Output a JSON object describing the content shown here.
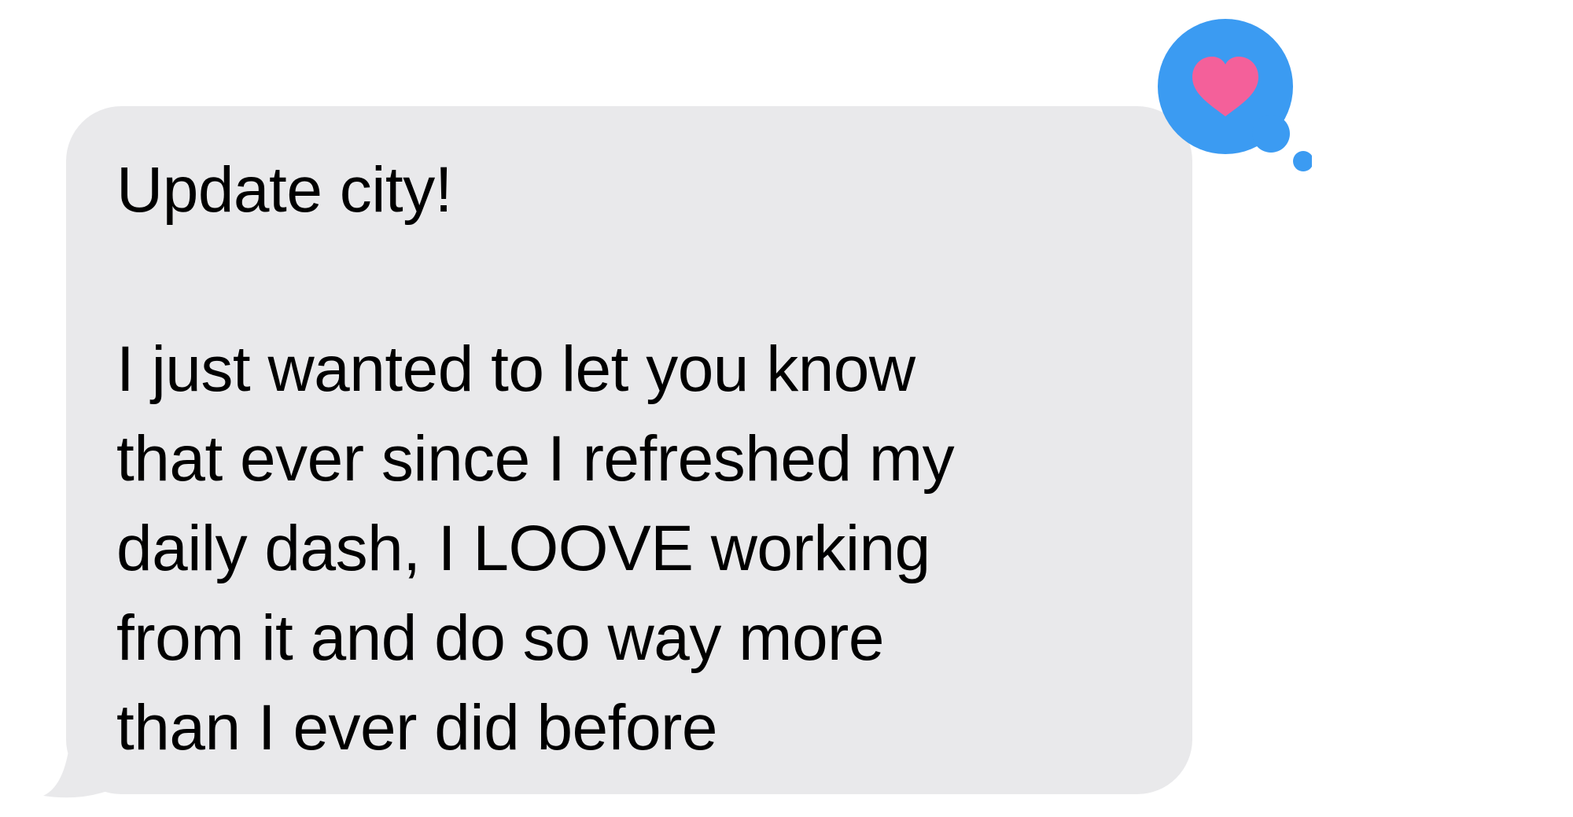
{
  "message": {
    "line1": "Update city!",
    "line2": "I just wanted to let you know",
    "line3": "that ever since I refreshed my",
    "line4": "daily dash, I LOOVE working",
    "line5": "from it and do so way more",
    "line6": "than I ever did before"
  },
  "tapback": {
    "icon": "heart-icon",
    "bubble_color": "#3b9bf2",
    "heart_color": "#f4609a"
  },
  "colors": {
    "bubble_background": "#e9e9eb",
    "text": "#000000"
  }
}
